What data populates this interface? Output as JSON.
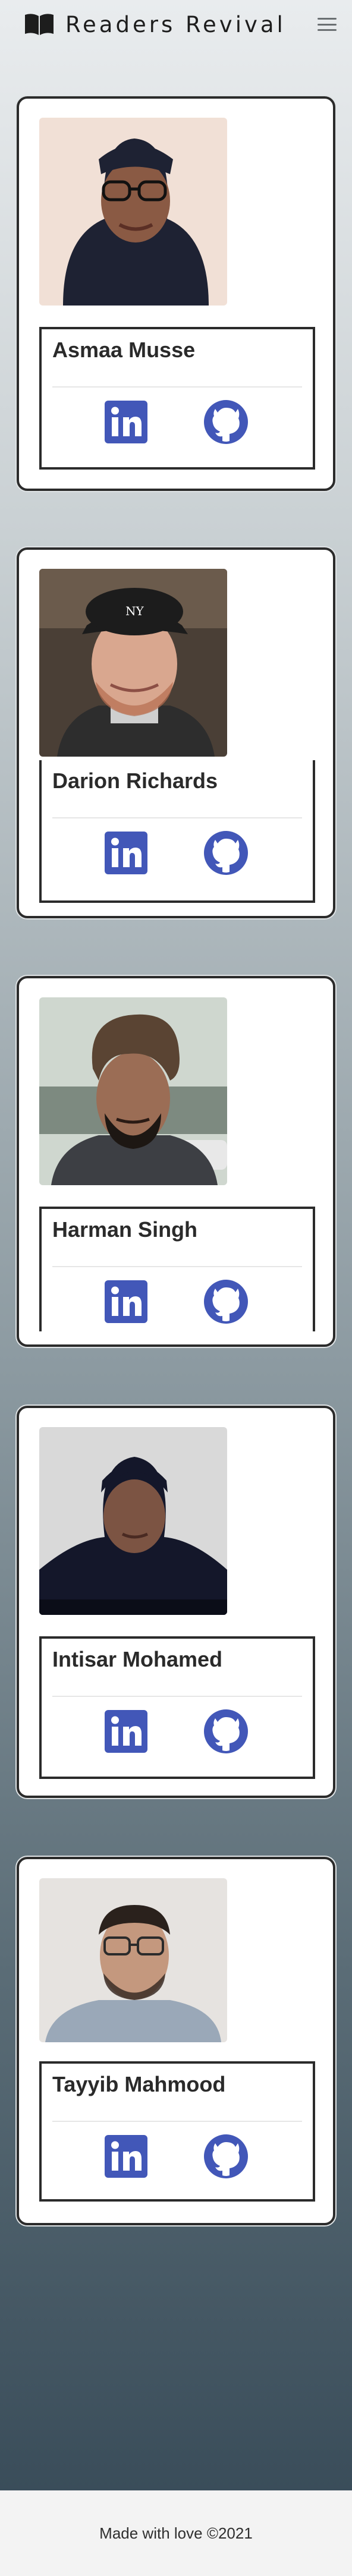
{
  "navbar": {
    "brand": "Readers Revival",
    "icons": {
      "brand": "open-book-icon",
      "menu": "hamburger-menu-icon"
    }
  },
  "team": [
    {
      "name": "Asmaa Musse",
      "photo": "person-portrait",
      "skin": "#8a5a44",
      "garment": "#1e2233",
      "bg": "#f1e0d6",
      "links": [
        "linkedin-icon",
        "github-icon"
      ]
    },
    {
      "name": "Darion Richards",
      "photo": "person-portrait",
      "skin": "#d9a78f",
      "garment": "#2d2d2d",
      "bg": "#4a3f36",
      "links": [
        "linkedin-icon",
        "github-icon"
      ]
    },
    {
      "name": "Harman Singh",
      "photo": "person-portrait",
      "skin": "#9b6d55",
      "garment": "#3d3f44",
      "bg": "#cfd7cf",
      "links": [
        "linkedin-icon",
        "github-icon"
      ]
    },
    {
      "name": "Intisar Mohamed",
      "photo": "person-portrait",
      "skin": "#7c5443",
      "garment": "#14172a",
      "bg": "#d9d9d9",
      "links": [
        "linkedin-icon",
        "github-icon"
      ]
    },
    {
      "name": "Tayyib Mahmood",
      "photo": "person-portrait",
      "skin": "#c4987e",
      "garment": "#9aa8b8",
      "bg": "#e6e3e0",
      "links": [
        "linkedin-icon",
        "github-icon"
      ]
    }
  ],
  "colors": {
    "icon_blue": "#4257b8",
    "border": "#2b2b2b"
  },
  "footer": {
    "text": "Made with love ©2021"
  }
}
